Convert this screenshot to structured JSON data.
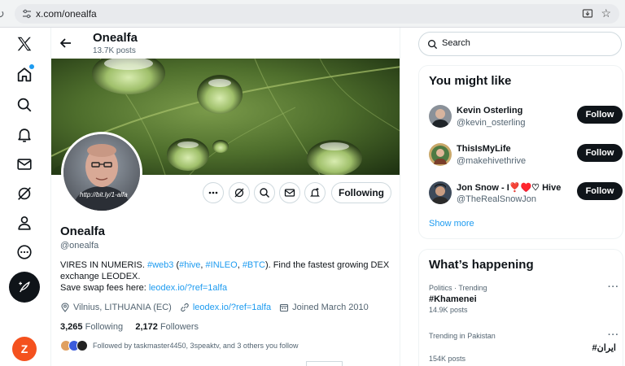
{
  "browser": {
    "url": "x.com/onealfa"
  },
  "nav": {
    "items": [
      "x-logo",
      "home",
      "explore",
      "notifications",
      "messages",
      "grok",
      "profile",
      "more"
    ],
    "avatar_letter": "Z"
  },
  "header": {
    "name": "Onealfa",
    "posts": "13.7K posts"
  },
  "profile": {
    "avatar_text": "http://bit.ly/1-alfa",
    "following_label": "Following",
    "name": "Onealfa",
    "handle": "@onealfa",
    "bio": {
      "part1": "VIRES IN NUMERIS. ",
      "tag_web3": "#web3",
      "part2": " (",
      "tag_hive": "#hive",
      "part3": ", ",
      "tag_inleo": "#INLEO",
      "part4": ",  ",
      "tag_btc": "#BTC",
      "part5": ").  Find the fastest growing DEX exchange LEODEX.",
      "part6": "Save swap fees here:  ",
      "link": "leodex.io/?ref=1alfa"
    },
    "location": "Vilnius, LITHUANIA (EC)",
    "website": "leodex.io/?ref=1alfa",
    "joined": "Joined March 2010",
    "following_count": "3,265",
    "following_text": "Following",
    "followers_count": "2,172",
    "followers_text": "Followers",
    "followed_by": "Followed by taskmaster4450, 3speaktv, and 3 others you follow"
  },
  "search": {
    "placeholder": "Search"
  },
  "suggestions": {
    "title": "You might like",
    "users": [
      {
        "name": "Kevin Osterling",
        "handle": "@kevin_osterling",
        "button": "Follow"
      },
      {
        "name": "ThisIsMyLife",
        "handle": "@makehivethrive",
        "button": "Follow"
      },
      {
        "name": "Jon Snow - I❣️♥️♡ Hive",
        "handle": "@TheRealSnowJon",
        "button": "Follow"
      }
    ],
    "show_more": "Show more"
  },
  "trends": {
    "title": "What’s happening",
    "items": [
      {
        "context": "Politics · Trending",
        "name": "#Khamenei",
        "count": "14.9K posts"
      },
      {
        "context": "Trending in Pakistan",
        "name": "#ایران",
        "count": "154K posts"
      }
    ]
  },
  "colors": {
    "accent": "#1d9bf0",
    "text": "#0f1419",
    "muted": "#536471",
    "avatar_z": "#f4511e"
  }
}
